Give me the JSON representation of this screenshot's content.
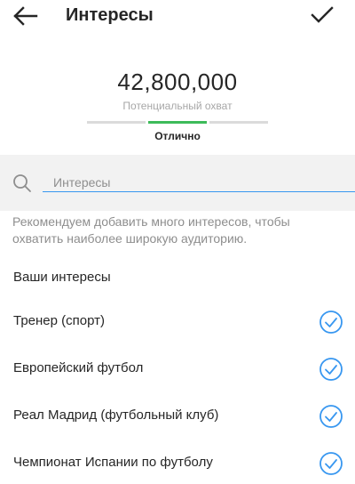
{
  "header": {
    "title": "Интересы",
    "back_icon": "arrow-left-icon",
    "done_icon": "checkmark-icon"
  },
  "reach": {
    "value": "42,800,000",
    "label": "Потенциальный охват",
    "meter_level": 2,
    "meter_segments": 3,
    "status": "Отлично"
  },
  "search": {
    "placeholder": "Интересы",
    "value": "",
    "icon": "search-icon"
  },
  "hint": "Рекомендуем добавить много интересов, чтобы охватить наиболее широкую аудиторию.",
  "interests": {
    "title": "Ваши интересы",
    "items": [
      {
        "label": "Тренер (спорт)",
        "selected": true
      },
      {
        "label": "Европейский футбол",
        "selected": true
      },
      {
        "label": "Реал Мадрид (футбольный клуб)",
        "selected": true
      },
      {
        "label": "Чемпионат Испании по футболу",
        "selected": true
      }
    ]
  },
  "colors": {
    "accent": "#3897f0",
    "meter_active": "#3dbb5a",
    "check": "#3897f0"
  }
}
